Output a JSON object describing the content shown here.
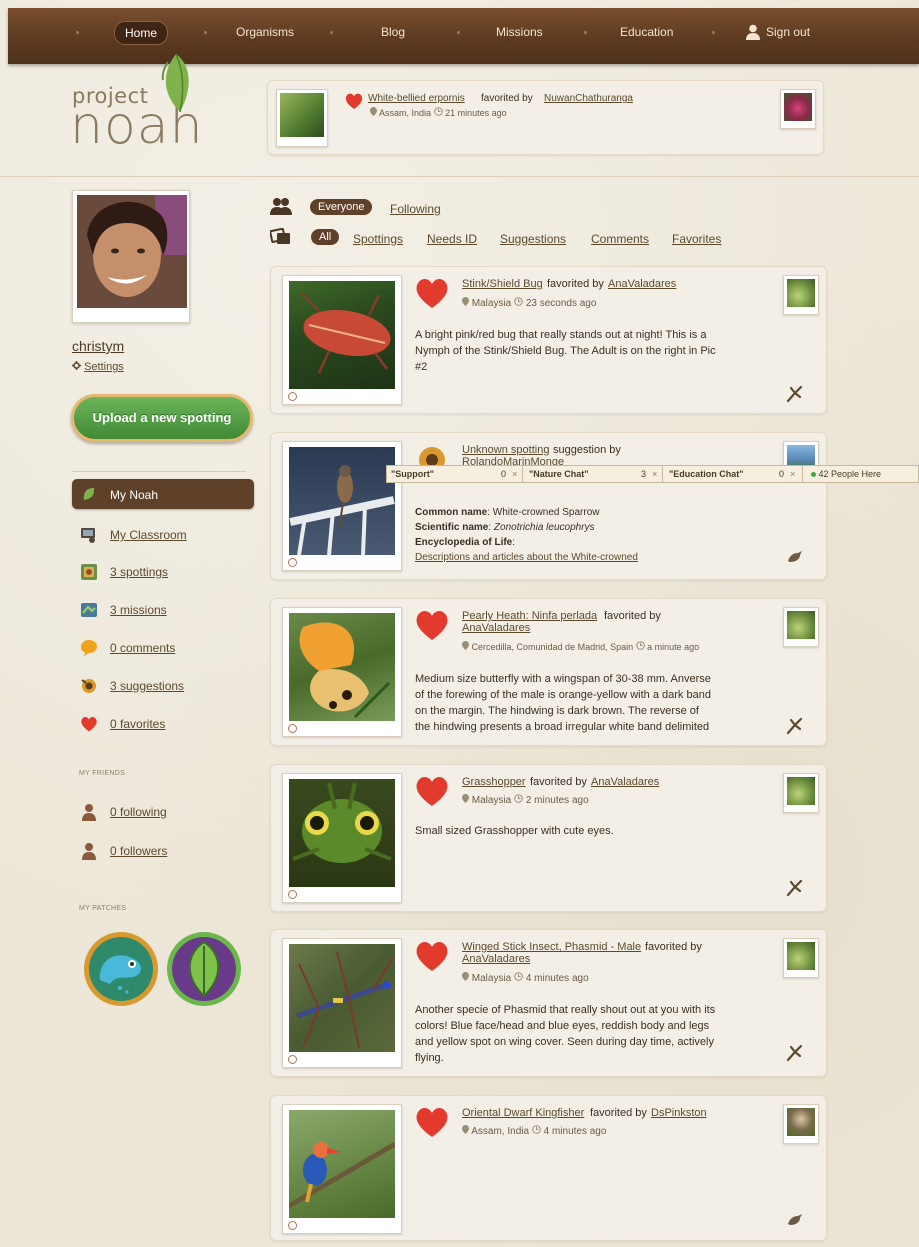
{
  "nav": {
    "home": "Home",
    "organisms": "Organisms",
    "blog": "Blog",
    "missions": "Missions",
    "education": "Education",
    "signout": "Sign out"
  },
  "logo": {
    "line1": "project",
    "line2": "noah"
  },
  "ticker": {
    "title": "White-bellied erpornis",
    "favorited_by": "favorited by",
    "user": "NuwanChathuranga",
    "location": "Assam, India",
    "time": "21 minutes ago"
  },
  "profile": {
    "username": "christym",
    "settings": "Settings",
    "upload": "Upload a new spotting"
  },
  "sidebar": {
    "items": [
      {
        "label": "My Noah",
        "icon": "leaf-icon"
      },
      {
        "label": "My Classroom",
        "icon": "classroom-icon"
      },
      {
        "label": "3 spottings",
        "icon": "spottings-icon"
      },
      {
        "label": "3 missions",
        "icon": "missions-icon"
      },
      {
        "label": "0 comments",
        "icon": "comment-icon"
      },
      {
        "label": "3 suggestions",
        "icon": "suggestion-icon"
      },
      {
        "label": "0 favorites",
        "icon": "heart-icon"
      }
    ],
    "friends_header": "MY FRIENDS",
    "following": "0 following",
    "followers": "0 followers",
    "patches_header": "MY PATCHES"
  },
  "filters": {
    "everyone": "Everyone",
    "following": "Following",
    "all": "All",
    "spottings": "Spottings",
    "needs_id": "Needs ID",
    "suggestions": "Suggestions",
    "comments": "Comments",
    "favorites": "Favorites"
  },
  "chat": {
    "support": "\"Support\"",
    "support_count": "0",
    "nature": "\"Nature Chat\"",
    "nature_count": "3",
    "education": "\"Education Chat\"",
    "education_count": "0",
    "people": "42 People Here"
  },
  "feed": [
    {
      "title": "Stink/Shield Bug",
      "verb": "favorited by",
      "user": "AnaValadares",
      "location": "Malaysia",
      "time": "23 seconds ago",
      "desc": [
        "A bright pink/red bug that really stands out at night! This is a",
        "Nymph of the Stink/Shield Bug. The Adult is on the right in Pic",
        "#2"
      ]
    },
    {
      "title": "Unknown spotting",
      "verb": "suggestion by",
      "user": "RolandoMarinMonge",
      "common_label": "Common name",
      "common_value": "White-crowned Sparrow",
      "sci_label": "Scientific name",
      "sci_value": "Zonotrichia leucophrys",
      "enc_label": "Encyclopedia of Life",
      "enc_link": "Descriptions and articles about the White-crowned"
    },
    {
      "title": "Pearly Heath: Ninfa perlada",
      "verb": "favorited by",
      "user": "AnaValadares",
      "location": "Cercedilla, Comunidad de Madrid, Spain",
      "time": "a minute ago",
      "desc": [
        "Medium size butterfly with a wingspan of 30-38 mm. Anverse",
        "of the forewing of the male is orange-yellow with a dark band",
        "on the margin. The hindwing is dark brown. The reverse of",
        "the hindwing presents a broad irregular white band delimited"
      ]
    },
    {
      "title": "Grasshopper",
      "verb": "favorited by",
      "user": "AnaValadares",
      "location": "Malaysia",
      "time": "2 minutes ago",
      "desc": [
        "Small sized Grasshopper with cute eyes."
      ]
    },
    {
      "title": "Winged Stick Insect, Phasmid - Male",
      "verb": "favorited by",
      "user": "AnaValadares",
      "location": "Malaysia",
      "time": "4 minutes ago",
      "desc": [
        "Another specie of Phasmid that really shout out at you with its",
        "colors! Blue face/head and blue eyes, reddish body and legs",
        "and yellow spot on wing cover. Seen during day time, actively",
        "flying."
      ]
    },
    {
      "title": "Oriental Dwarf Kingfisher",
      "verb": "favorited by",
      "user": "DsPinkston",
      "location": "Assam, India",
      "time": "4 minutes ago"
    }
  ],
  "colors": {
    "nav": "#5d3a21",
    "accent": "#5e4128",
    "heart": "#e23b2e",
    "upload": "#4f9a40"
  }
}
